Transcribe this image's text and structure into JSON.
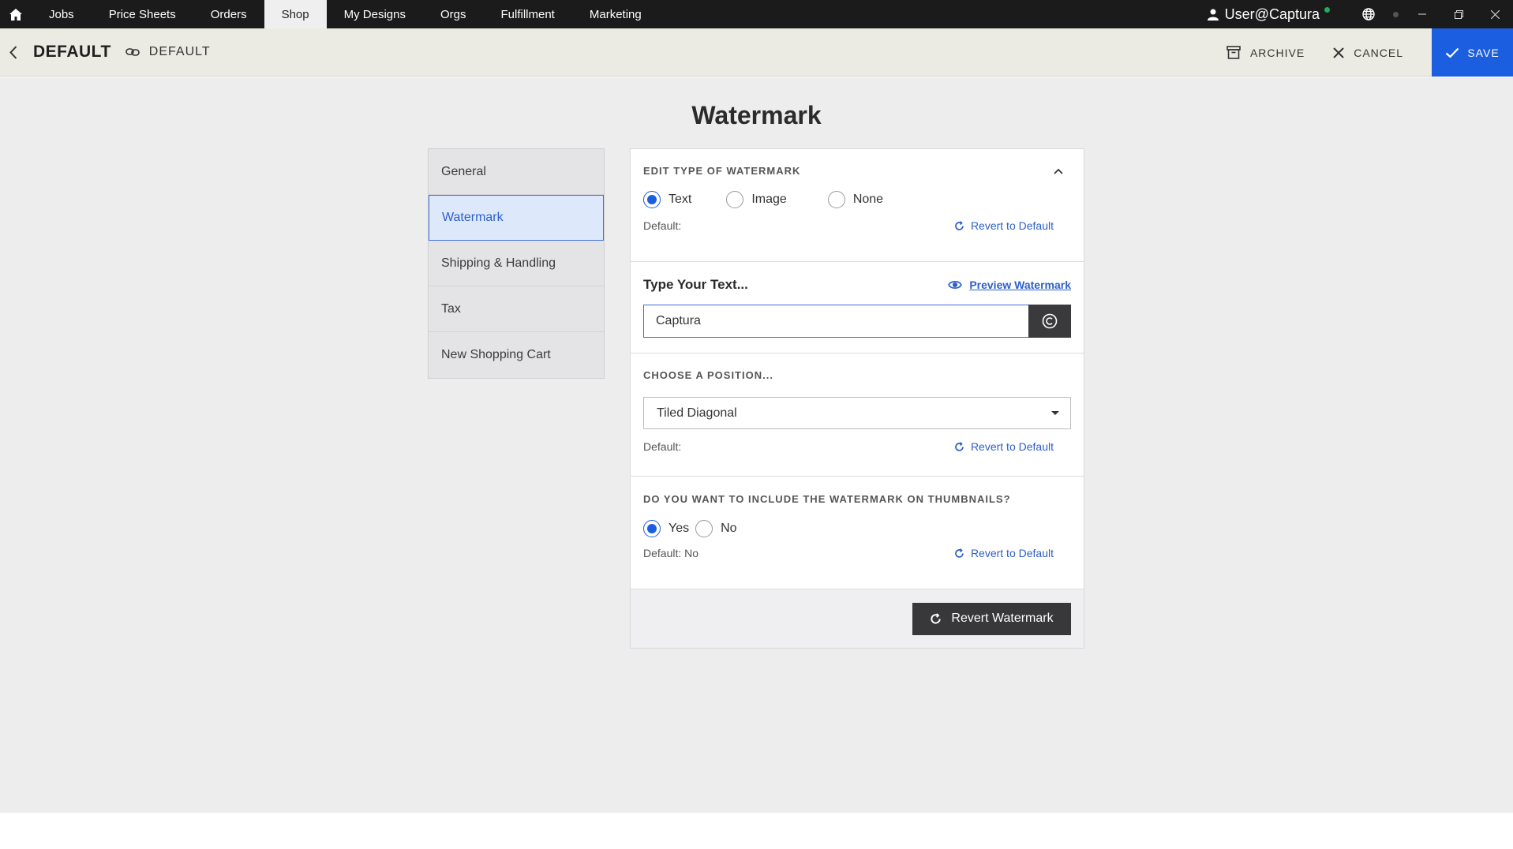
{
  "topnav": {
    "items": [
      {
        "label": "Jobs"
      },
      {
        "label": "Price Sheets"
      },
      {
        "label": "Orders"
      },
      {
        "label": "Shop"
      },
      {
        "label": "My Designs"
      },
      {
        "label": "Orgs"
      },
      {
        "label": "Fulfillment"
      },
      {
        "label": "Marketing"
      }
    ],
    "active": "Shop",
    "user": "User@Captura"
  },
  "subheader": {
    "title": "DEFAULT",
    "linked_name": "DEFAULT",
    "archive_label": "ARCHIVE",
    "cancel_label": "CANCEL",
    "save_label": "SAVE",
    "save_color": "#1c5ee0"
  },
  "page": {
    "heading": "Watermark"
  },
  "sidemenu": {
    "items": [
      {
        "label": "General"
      },
      {
        "label": "Watermark"
      },
      {
        "label": "Shipping & Handling"
      },
      {
        "label": "Tax"
      },
      {
        "label": "New Shopping Cart"
      }
    ],
    "active": "Watermark"
  },
  "type_section": {
    "title": "EDIT TYPE OF WATERMARK",
    "options": [
      {
        "label": "Text",
        "selected": true
      },
      {
        "label": "Image",
        "selected": false
      },
      {
        "label": "None",
        "selected": false
      }
    ],
    "default_label": "Default:",
    "revert_label": "Revert to Default"
  },
  "text_section": {
    "label": "Type Your Text...",
    "preview_label": "Preview Watermark",
    "value": "Captura "
  },
  "position_section": {
    "title": "CHOOSE A POSITION...",
    "selected": "Tiled Diagonal",
    "default_label": "Default:",
    "revert_label": "Revert to Default"
  },
  "thumb_section": {
    "title": "DO YOU WANT TO INCLUDE THE WATERMARK ON THUMBNAILS?",
    "options": [
      {
        "label": "Yes",
        "selected": true
      },
      {
        "label": "No",
        "selected": false
      }
    ],
    "default_label": "Default: No",
    "revert_label": "Revert to Default"
  },
  "footer": {
    "revert_watermark_label": "Revert Watermark"
  }
}
